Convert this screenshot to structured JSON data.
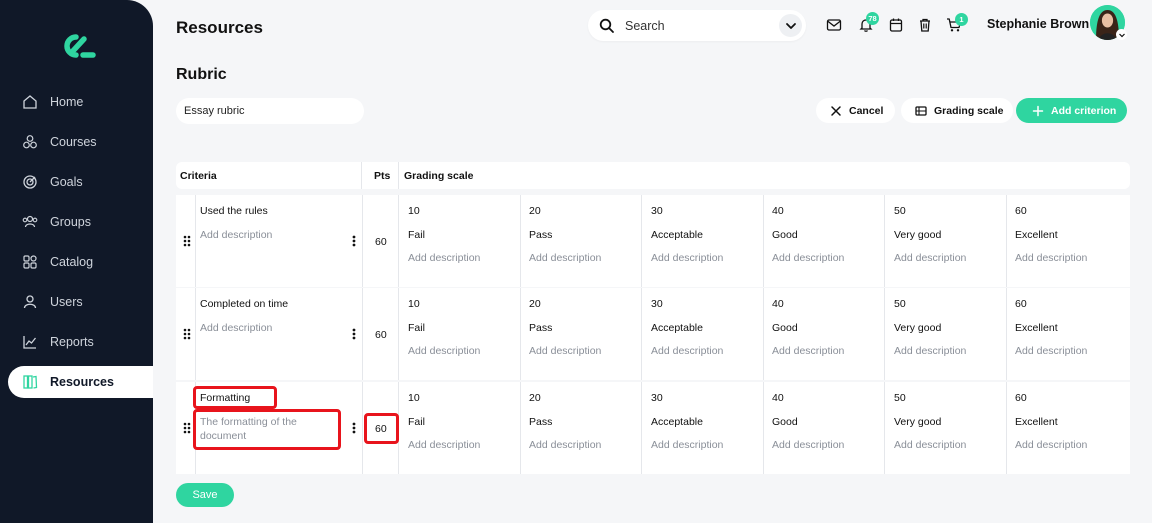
{
  "header": {
    "title": "Resources",
    "search_placeholder": "Search",
    "notifications_count": "78",
    "cart_count": "1",
    "user_name": "Stephanie Brown"
  },
  "nav": [
    {
      "label": "Home",
      "icon": "home-icon"
    },
    {
      "label": "Courses",
      "icon": "courses-icon"
    },
    {
      "label": "Goals",
      "icon": "goals-icon"
    },
    {
      "label": "Groups",
      "icon": "groups-icon"
    },
    {
      "label": "Catalog",
      "icon": "catalog-icon"
    },
    {
      "label": "Users",
      "icon": "users-icon"
    },
    {
      "label": "Reports",
      "icon": "reports-icon"
    },
    {
      "label": "Resources",
      "icon": "resources-icon",
      "active": true
    }
  ],
  "rubric": {
    "section_title": "Rubric",
    "name_value": "Essay rubric",
    "cancel_label": "Cancel",
    "grading_scale_label": "Grading scale",
    "add_criterion_label": "Add criterion",
    "save_label": "Save"
  },
  "table": {
    "headers": {
      "criteria": "Criteria",
      "pts": "Pts",
      "grading": "Grading scale"
    },
    "rows": [
      {
        "title": "Used the rules",
        "description": "Add description",
        "pts": "60",
        "grades": [
          {
            "value": "10",
            "label": "Fail",
            "description": "Add description"
          },
          {
            "value": "20",
            "label": "Pass",
            "description": "Add description"
          },
          {
            "value": "30",
            "label": "Acceptable",
            "description": "Add description"
          },
          {
            "value": "40",
            "label": "Good",
            "description": "Add description"
          },
          {
            "value": "50",
            "label": "Very good",
            "description": "Add description"
          },
          {
            "value": "60",
            "label": "Excellent",
            "description": "Add description"
          }
        ]
      },
      {
        "title": "Completed on time",
        "description": "Add description",
        "pts": "60",
        "grades": [
          {
            "value": "10",
            "label": "Fail",
            "description": "Add description"
          },
          {
            "value": "20",
            "label": "Pass",
            "description": "Add description"
          },
          {
            "value": "30",
            "label": "Acceptable",
            "description": "Add description"
          },
          {
            "value": "40",
            "label": "Good",
            "description": "Add description"
          },
          {
            "value": "50",
            "label": "Very good",
            "description": "Add description"
          },
          {
            "value": "60",
            "label": "Excellent",
            "description": "Add description"
          }
        ]
      },
      {
        "title": "Formatting",
        "description": "The formatting of the document",
        "pts": "60",
        "grades": [
          {
            "value": "10",
            "label": "Fail",
            "description": "Add description"
          },
          {
            "value": "20",
            "label": "Pass",
            "description": "Add description"
          },
          {
            "value": "30",
            "label": "Acceptable",
            "description": "Add description"
          },
          {
            "value": "40",
            "label": "Good",
            "description": "Add description"
          },
          {
            "value": "50",
            "label": "Very good",
            "description": "Add description"
          },
          {
            "value": "60",
            "label": "Excellent",
            "description": "Add description"
          }
        ]
      }
    ]
  },
  "colors": {
    "accent": "#2fd5a0",
    "sidebar": "#101828",
    "highlight": "#e8141c"
  }
}
